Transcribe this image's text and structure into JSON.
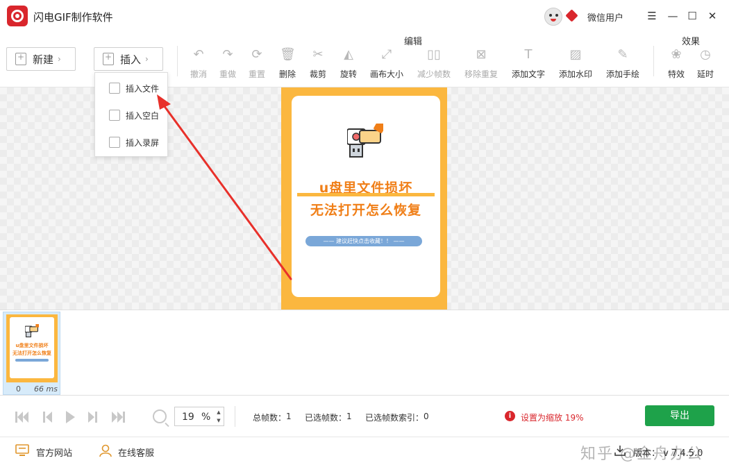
{
  "app": {
    "title": "闪电GIF制作软件",
    "user_name": "微信用户"
  },
  "window_controls": {
    "menu": "☰",
    "minimize": "—",
    "maximize": "☐",
    "close": "✕"
  },
  "toolbar": {
    "new_label": "新建",
    "insert_label": "插入",
    "edit_section": "编辑",
    "effect_section": "效果",
    "tools": [
      {
        "label": "撤消",
        "icon": "undo-icon",
        "glyph": "↶"
      },
      {
        "label": "重做",
        "icon": "redo-icon",
        "glyph": "↷"
      },
      {
        "label": "重置",
        "icon": "reset-icon",
        "glyph": "⟳"
      },
      {
        "label": "删除",
        "icon": "trash-icon",
        "glyph": "🗑"
      },
      {
        "label": "裁剪",
        "icon": "scissors-icon",
        "glyph": "✂"
      },
      {
        "label": "旋转",
        "icon": "rotate-icon",
        "glyph": "◭"
      },
      {
        "label": "画布大小",
        "icon": "canvas-size-icon",
        "glyph": "⤢"
      },
      {
        "label": "减少帧数",
        "icon": "reduce-frames-icon",
        "glyph": "▯▯"
      },
      {
        "label": "移除重复",
        "icon": "remove-duplicate-icon",
        "glyph": "⊠"
      },
      {
        "label": "添加文字",
        "icon": "text-icon",
        "glyph": "T"
      },
      {
        "label": "添加水印",
        "icon": "watermark-icon",
        "glyph": "▨"
      },
      {
        "label": "添加手绘",
        "icon": "pen-icon",
        "glyph": "✎"
      }
    ],
    "effects": [
      {
        "label": "特效",
        "icon": "effects-icon",
        "glyph": "❀"
      },
      {
        "label": "延时",
        "icon": "delay-icon",
        "glyph": "◷"
      }
    ]
  },
  "insert_menu": {
    "items": [
      {
        "label": "插入文件"
      },
      {
        "label": "插入空白"
      },
      {
        "label": "插入录屏"
      }
    ]
  },
  "frame_preview": {
    "title_line1": "u盘里文件损坏",
    "title_line2": "无法打开怎么恢复",
    "pill_text": "——   建议赶快点击收藏！！   ——"
  },
  "timeline": {
    "frames": [
      {
        "index": "0",
        "duration": "66 ms",
        "title_line1": "u盘里文件损坏",
        "title_line2": "无法打开怎么恢复"
      }
    ]
  },
  "controls": {
    "zoom_value": "19",
    "zoom_unit": "%",
    "total_frames_label": "总帧数：",
    "total_frames": "1",
    "selected_frames_label": "已选帧数：",
    "selected_frames": "1",
    "selected_index_label": "已选帧数索引：",
    "selected_index": "0",
    "warning": "设置为缩放 19%",
    "export_label": "导出"
  },
  "footer": {
    "official_site": "官方网站",
    "online_support": "在线客服",
    "watermark": "知乎 @金舟办公",
    "version": "版本：  v 7.4.5.0"
  },
  "colors": {
    "accent_red": "#d9262c",
    "export_green": "#1ea24a",
    "frame_orange": "#fbb73f",
    "title_orange": "#f07f18",
    "selection_blue": "#d7ebfa"
  }
}
